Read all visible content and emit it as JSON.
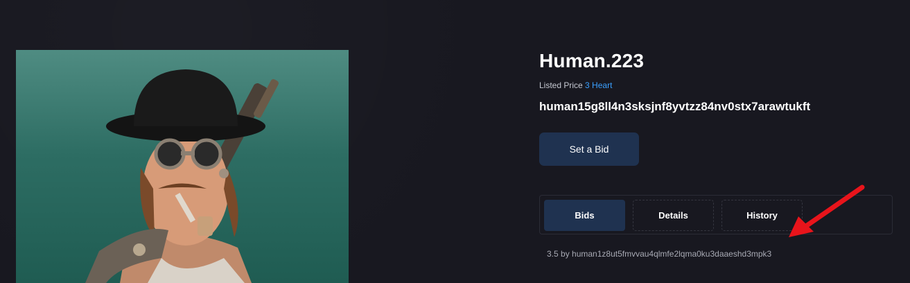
{
  "nft": {
    "title": "Human.223",
    "listed_price_label": "Listed Price",
    "listed_price_value": "3 Heart",
    "owner_address": "human15g8ll4n3sksjnf8yvtzz84nv0stx7arawtukft"
  },
  "actions": {
    "set_bid_label": "Set a Bid"
  },
  "tabs": [
    {
      "label": "Bids",
      "active": true
    },
    {
      "label": "Details",
      "active": false
    },
    {
      "label": "History",
      "active": false
    }
  ],
  "bids": [
    {
      "text": "3.5 by human1z8ut5fmvvau4qlmfe2lqma0ku3daaeshd3mpk3"
    }
  ],
  "colors": {
    "background": "#181820",
    "accent_button": "#1f3250",
    "price_link": "#3aa0ff",
    "annotation_arrow": "#e8141b"
  },
  "icons": {
    "artwork": "nft-character-artwork",
    "annotation": "red-arrow-icon"
  }
}
